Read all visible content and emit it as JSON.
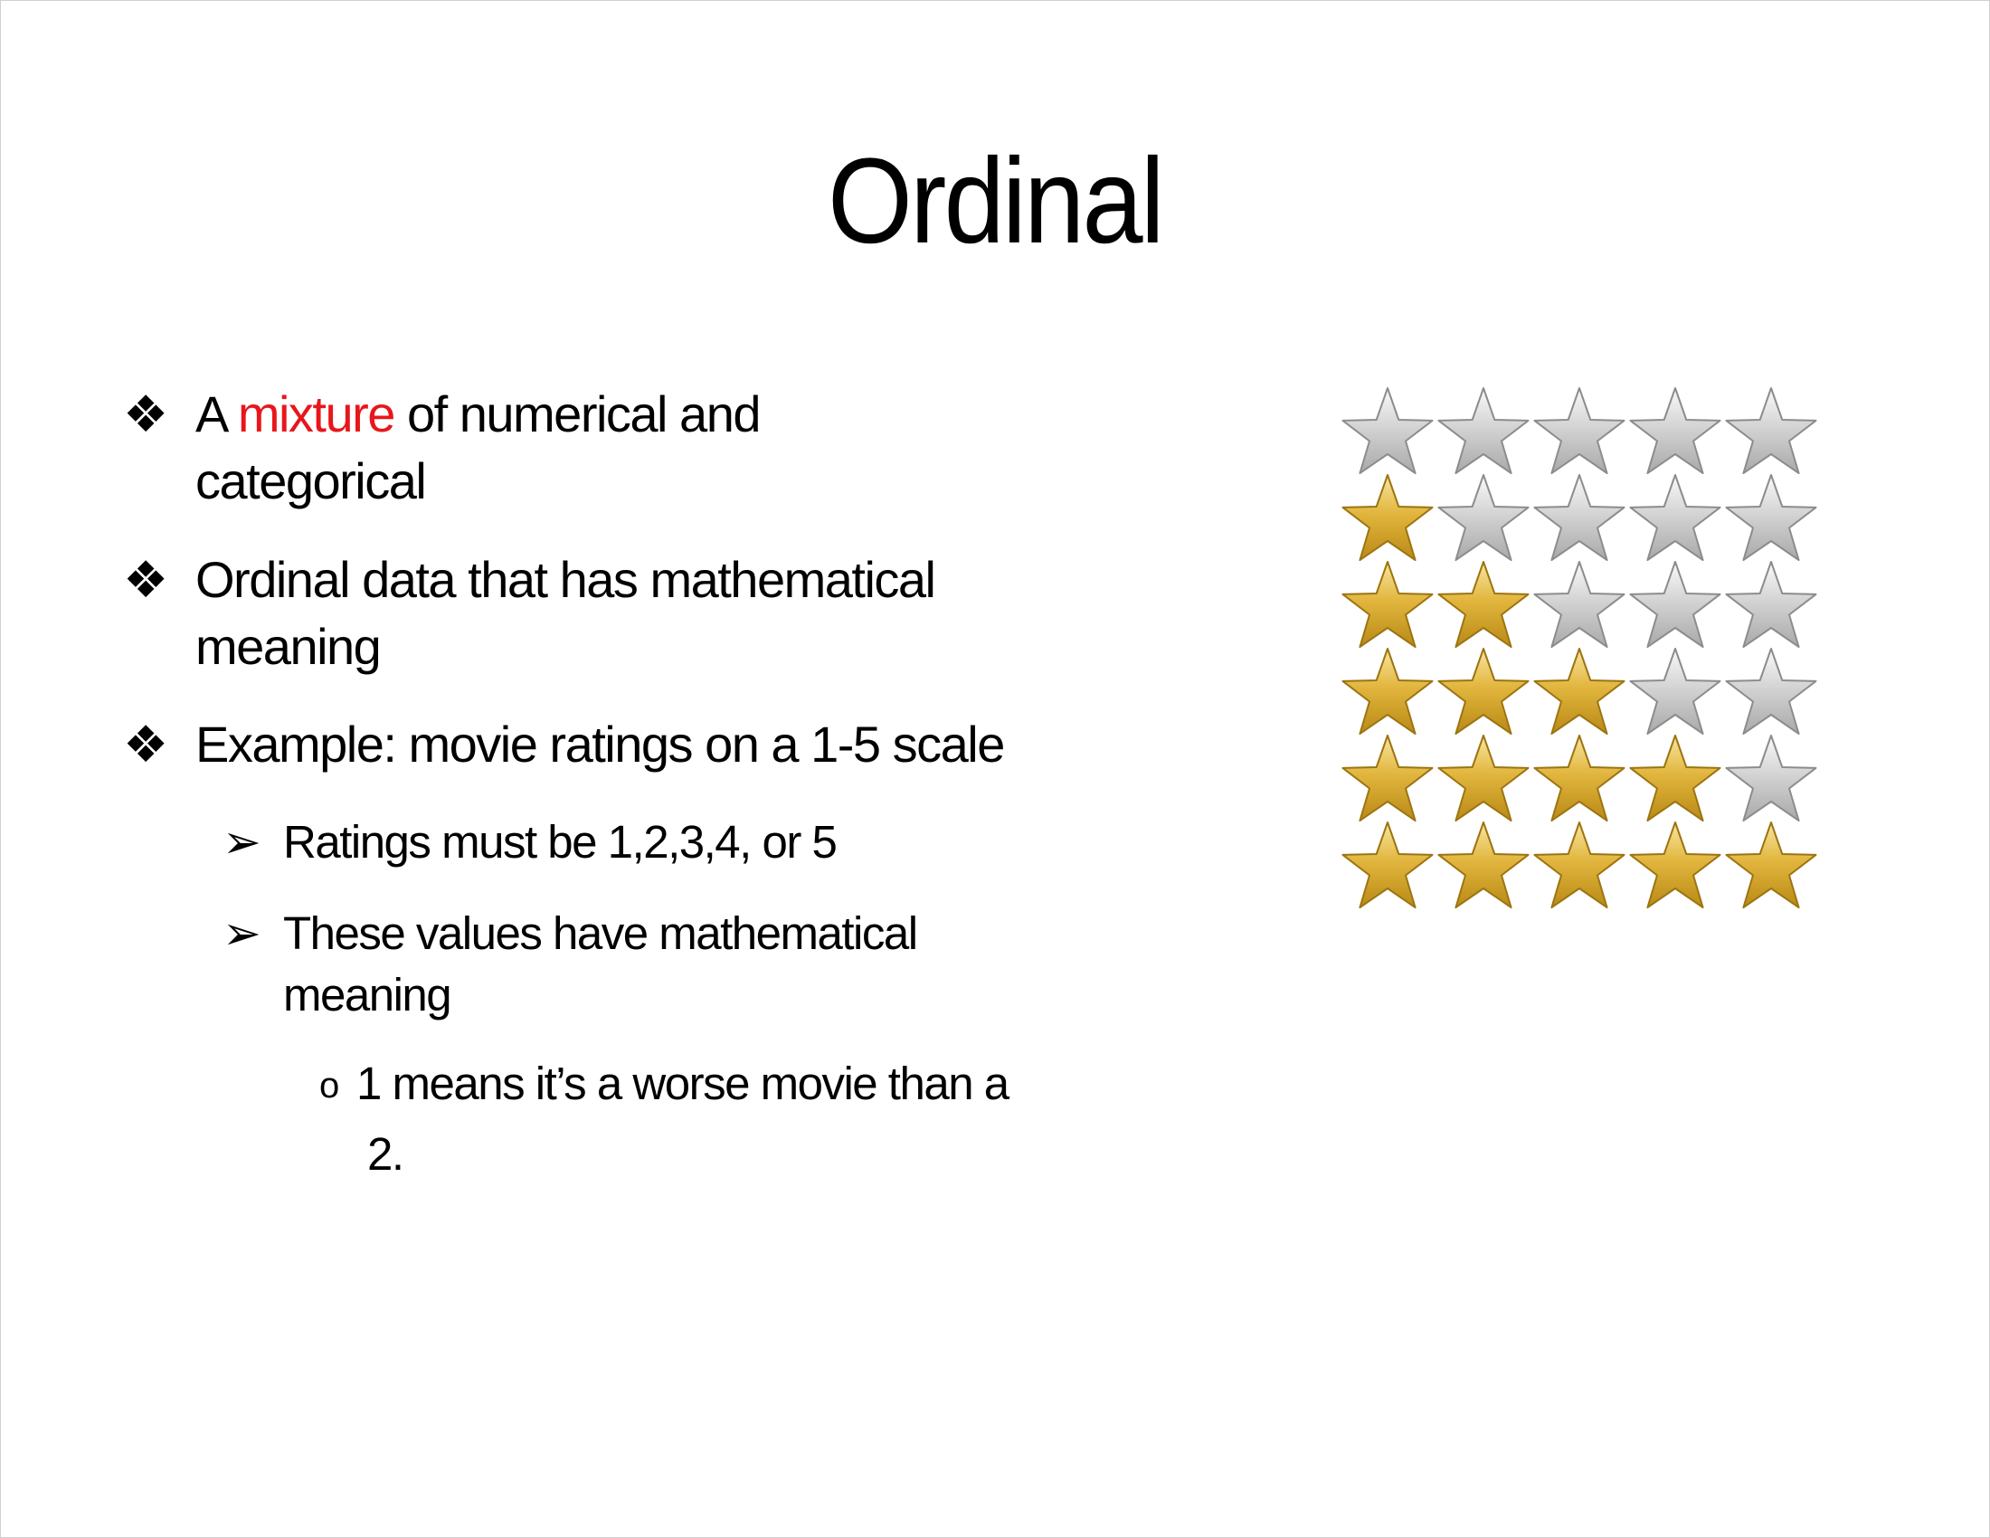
{
  "slide": {
    "title": "Ordinal",
    "bullets": {
      "b1_prefix": "A ",
      "b1_highlight": "mixture",
      "b1_rest": " of numerical and",
      "b1_line2": "categorical",
      "b2_line1": "Ordinal data that has mathematical",
      "b2_line2": "meaning",
      "b3_line1": "Example: movie ratings on a 1-5 scale",
      "s1_line1": "Ratings must be 1,2,3,4, or 5",
      "s2_line1": "These values have mathematical",
      "s2_line2": "meaning",
      "t1_line1": "1 means it’s a worse movie than a",
      "t1_line2": "2."
    },
    "glyphs": {
      "level1_bullet": "❖",
      "level2_bullet": "➢",
      "level3_bullet": "o"
    },
    "colors": {
      "highlight": "#e8161b",
      "gold_star": "#e2b63e",
      "gray_star": "#c8c8c8"
    },
    "star_ratings": {
      "max": 5,
      "rows": [
        0,
        1,
        2,
        3,
        4,
        5
      ]
    }
  }
}
